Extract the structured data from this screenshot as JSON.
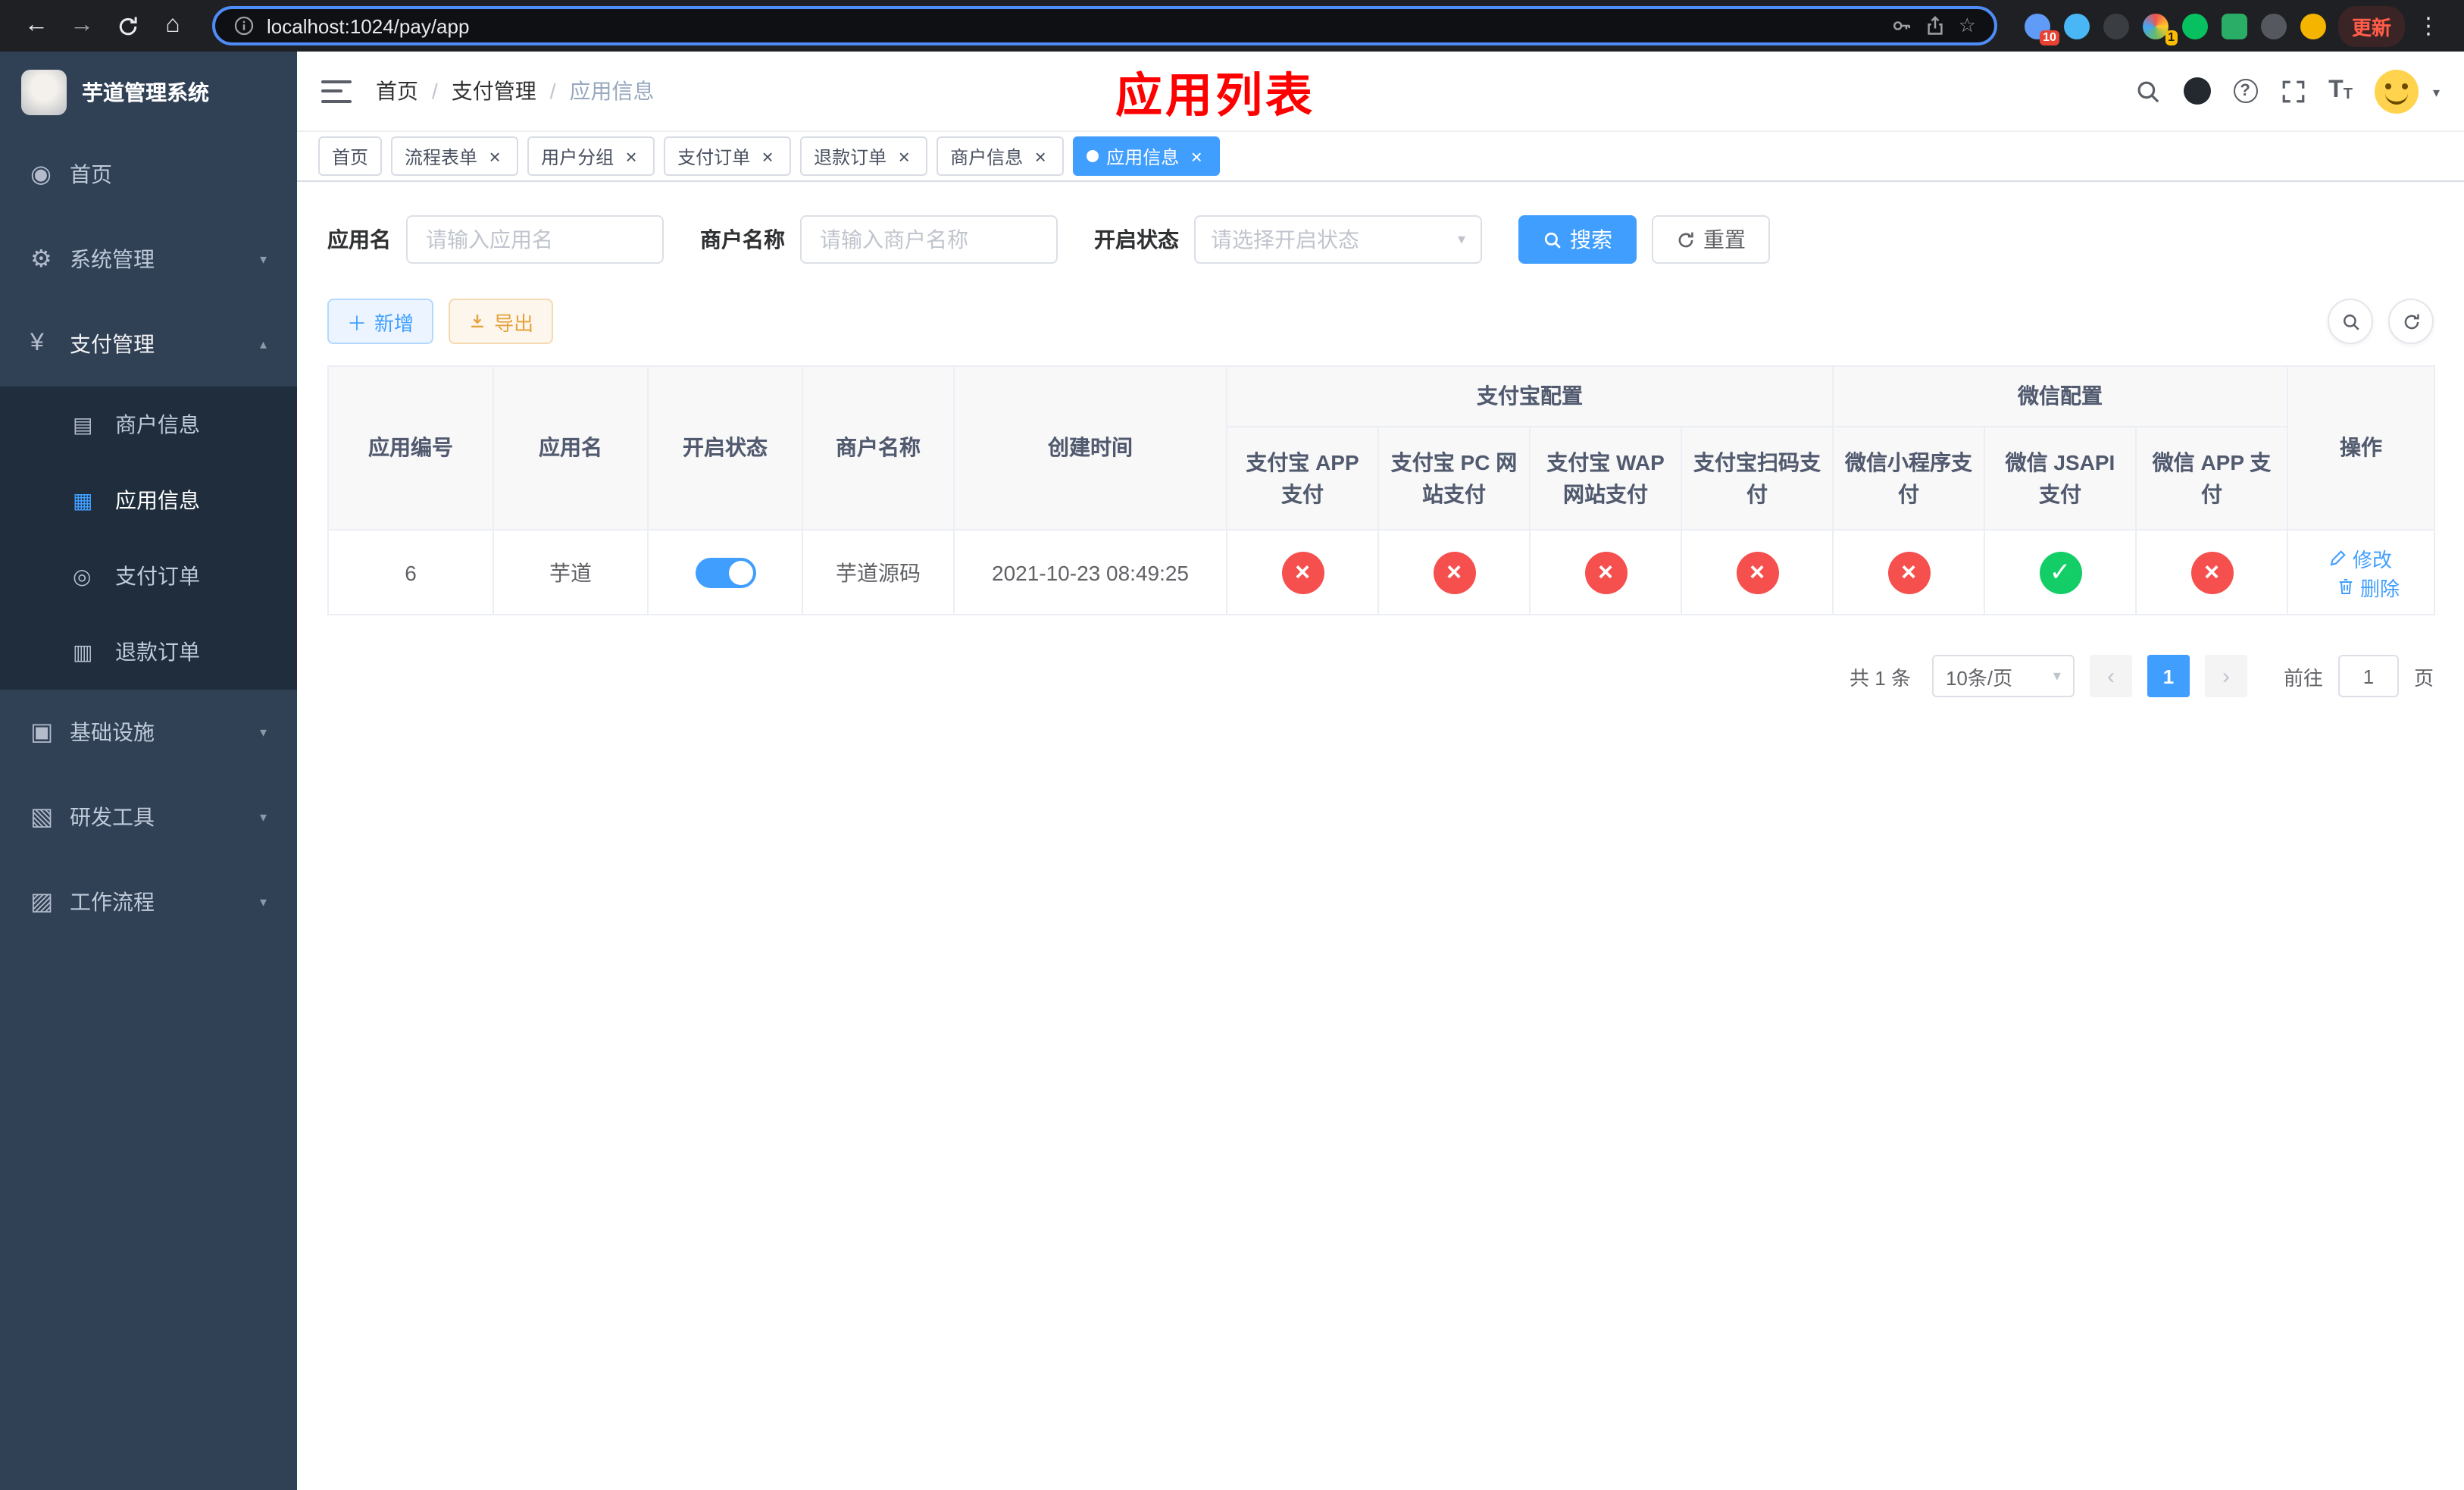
{
  "browser": {
    "url": "localhost:1024/pay/app",
    "update_label": "更新",
    "ext_badge_1": "10",
    "ext_badge_2": "1"
  },
  "sidebar": {
    "title": "芋道管理系统",
    "items": [
      {
        "label": "首页"
      },
      {
        "label": "系统管理"
      },
      {
        "label": "支付管理",
        "children": [
          {
            "label": "商户信息"
          },
          {
            "label": "应用信息"
          },
          {
            "label": "支付订单"
          },
          {
            "label": "退款订单"
          }
        ]
      },
      {
        "label": "基础设施"
      },
      {
        "label": "研发工具"
      },
      {
        "label": "工作流程"
      }
    ]
  },
  "header": {
    "breadcrumb": [
      "首页",
      "支付管理",
      "应用信息"
    ],
    "annotation": "应用列表"
  },
  "tabs": [
    {
      "label": "首页"
    },
    {
      "label": "流程表单"
    },
    {
      "label": "用户分组"
    },
    {
      "label": "支付订单"
    },
    {
      "label": "退款订单"
    },
    {
      "label": "商户信息"
    },
    {
      "label": "应用信息"
    }
  ],
  "filters": {
    "app_name_label": "应用名",
    "app_name_placeholder": "请输入应用名",
    "merchant_label": "商户名称",
    "merchant_placeholder": "请输入商户名称",
    "status_label": "开启状态",
    "status_placeholder": "请选择开启状态",
    "search_label": "搜索",
    "reset_label": "重置"
  },
  "toolbar": {
    "add_label": "新增",
    "export_label": "导出"
  },
  "table": {
    "columns_simple": [
      "应用编号",
      "应用名",
      "开启状态",
      "商户名称",
      "创建时间"
    ],
    "group_alipay": "支付宝配置",
    "group_wechat": "微信配置",
    "columns_alipay": [
      "支付宝 APP 支付",
      "支付宝 PC 网站支付",
      "支付宝 WAP 网站支付",
      "支付宝扫码支付"
    ],
    "columns_wechat": [
      "微信小程序支付",
      "微信 JSAPI 支付",
      "微信 APP 支付"
    ],
    "column_actions": "操作",
    "rows": [
      {
        "id": "6",
        "name": "芋道",
        "enabled": true,
        "merchant": "芋道源码",
        "created_at": "2021-10-23 08:49:25",
        "channels": [
          "cross",
          "cross",
          "cross",
          "cross",
          "cross",
          "check",
          "cross"
        ],
        "edit_label": "修改",
        "delete_label": "删除"
      }
    ]
  },
  "pagination": {
    "total": "共 1 条",
    "page_size": "10条/页",
    "page": "1",
    "goto_label": "前往",
    "goto_value": "1",
    "goto_suffix": "页"
  },
  "colors": {
    "primary": "#409eff",
    "success": "#13ce66",
    "danger": "#f5504e",
    "warning": "#e6a23c",
    "sidebar_bg": "#304156",
    "submenu_bg": "#1f2d3d",
    "annotation_red": "#ff0000"
  }
}
